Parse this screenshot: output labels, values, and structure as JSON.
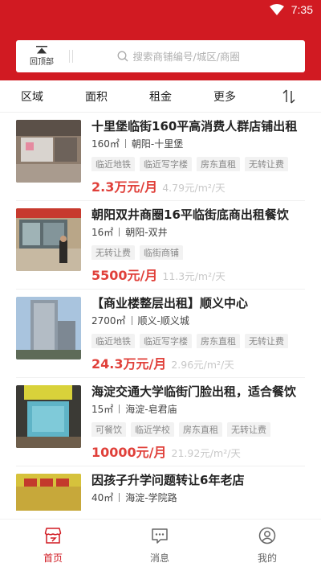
{
  "status_bar": {
    "time": "7:35"
  },
  "search": {
    "back_top_label": "回顶部",
    "placeholder": "搜索商铺编号/城区/商圈"
  },
  "filters": [
    "区域",
    "面积",
    "租金",
    "更多"
  ],
  "listings": [
    {
      "title": "十里堡临街160平高消费人群店铺出租",
      "area": "160㎡",
      "location": "朝阳-十里堡",
      "tags": [
        "临近地铁",
        "临近写字楼",
        "房东直租",
        "无转让费"
      ],
      "price": "2.3万元/月",
      "unit_price": "4.79元/m²/天"
    },
    {
      "title": "朝阳双井商圈16平临街底商出租餐饮",
      "area": "16㎡",
      "location": "朝阳-双井",
      "tags": [
        "无转让费",
        "临街商铺"
      ],
      "price": "5500元/月",
      "unit_price": "11.3元/m²/天"
    },
    {
      "title": "【商业楼整层出租】顺义中心",
      "area": "2700㎡",
      "location": "顺义-顺义城",
      "tags": [
        "临近地铁",
        "临近写字楼",
        "房东直租",
        "无转让费"
      ],
      "price": "24.3万元/月",
      "unit_price": "2.96元/m²/天"
    },
    {
      "title": "海淀交通大学临街门脸出租，适合餐饮",
      "area": "15㎡",
      "location": "海淀-皂君庙",
      "tags": [
        "可餐饮",
        "临近学校",
        "房东直租",
        "无转让费"
      ],
      "price": "10000元/月",
      "unit_price": "21.92元/m²/天"
    },
    {
      "title": "因孩子升学问题转让6年老店",
      "area": "40㎡",
      "location": "海淀-学院路",
      "tags": [],
      "price": "",
      "unit_price": ""
    }
  ],
  "tabbar": [
    {
      "label": "首页",
      "icon": "home-store-icon",
      "active": true
    },
    {
      "label": "消息",
      "icon": "message-icon",
      "active": false
    },
    {
      "label": "我的",
      "icon": "profile-icon",
      "active": false
    }
  ],
  "colors": {
    "brand": "#d11a22",
    "price": "#e0403a"
  }
}
